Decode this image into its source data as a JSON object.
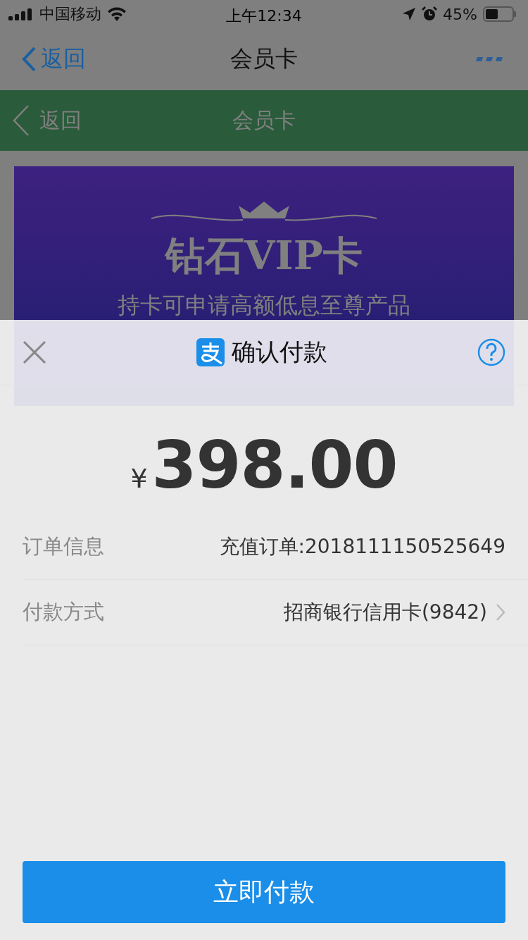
{
  "status_bar": {
    "carrier": "中国移动",
    "time": "上午12:34",
    "battery": "45%"
  },
  "nav_bar": {
    "back": "返回",
    "title": "会员卡"
  },
  "web_header": {
    "back": "返回",
    "title": "会员卡"
  },
  "banner": {
    "title": "钻石VIP卡",
    "subtitle": "持卡可申请高额低息至尊产品"
  },
  "payment_sheet": {
    "title": "确认付款",
    "currency": "¥",
    "amount": "398.00",
    "rows": [
      {
        "label": "订单信息",
        "value": "充值订单:2018111150525649",
        "kind": "plain"
      },
      {
        "label": "付款方式",
        "value": "招商银行信用卡(9842)",
        "kind": "link"
      }
    ],
    "pay_button": "立即付款"
  }
}
